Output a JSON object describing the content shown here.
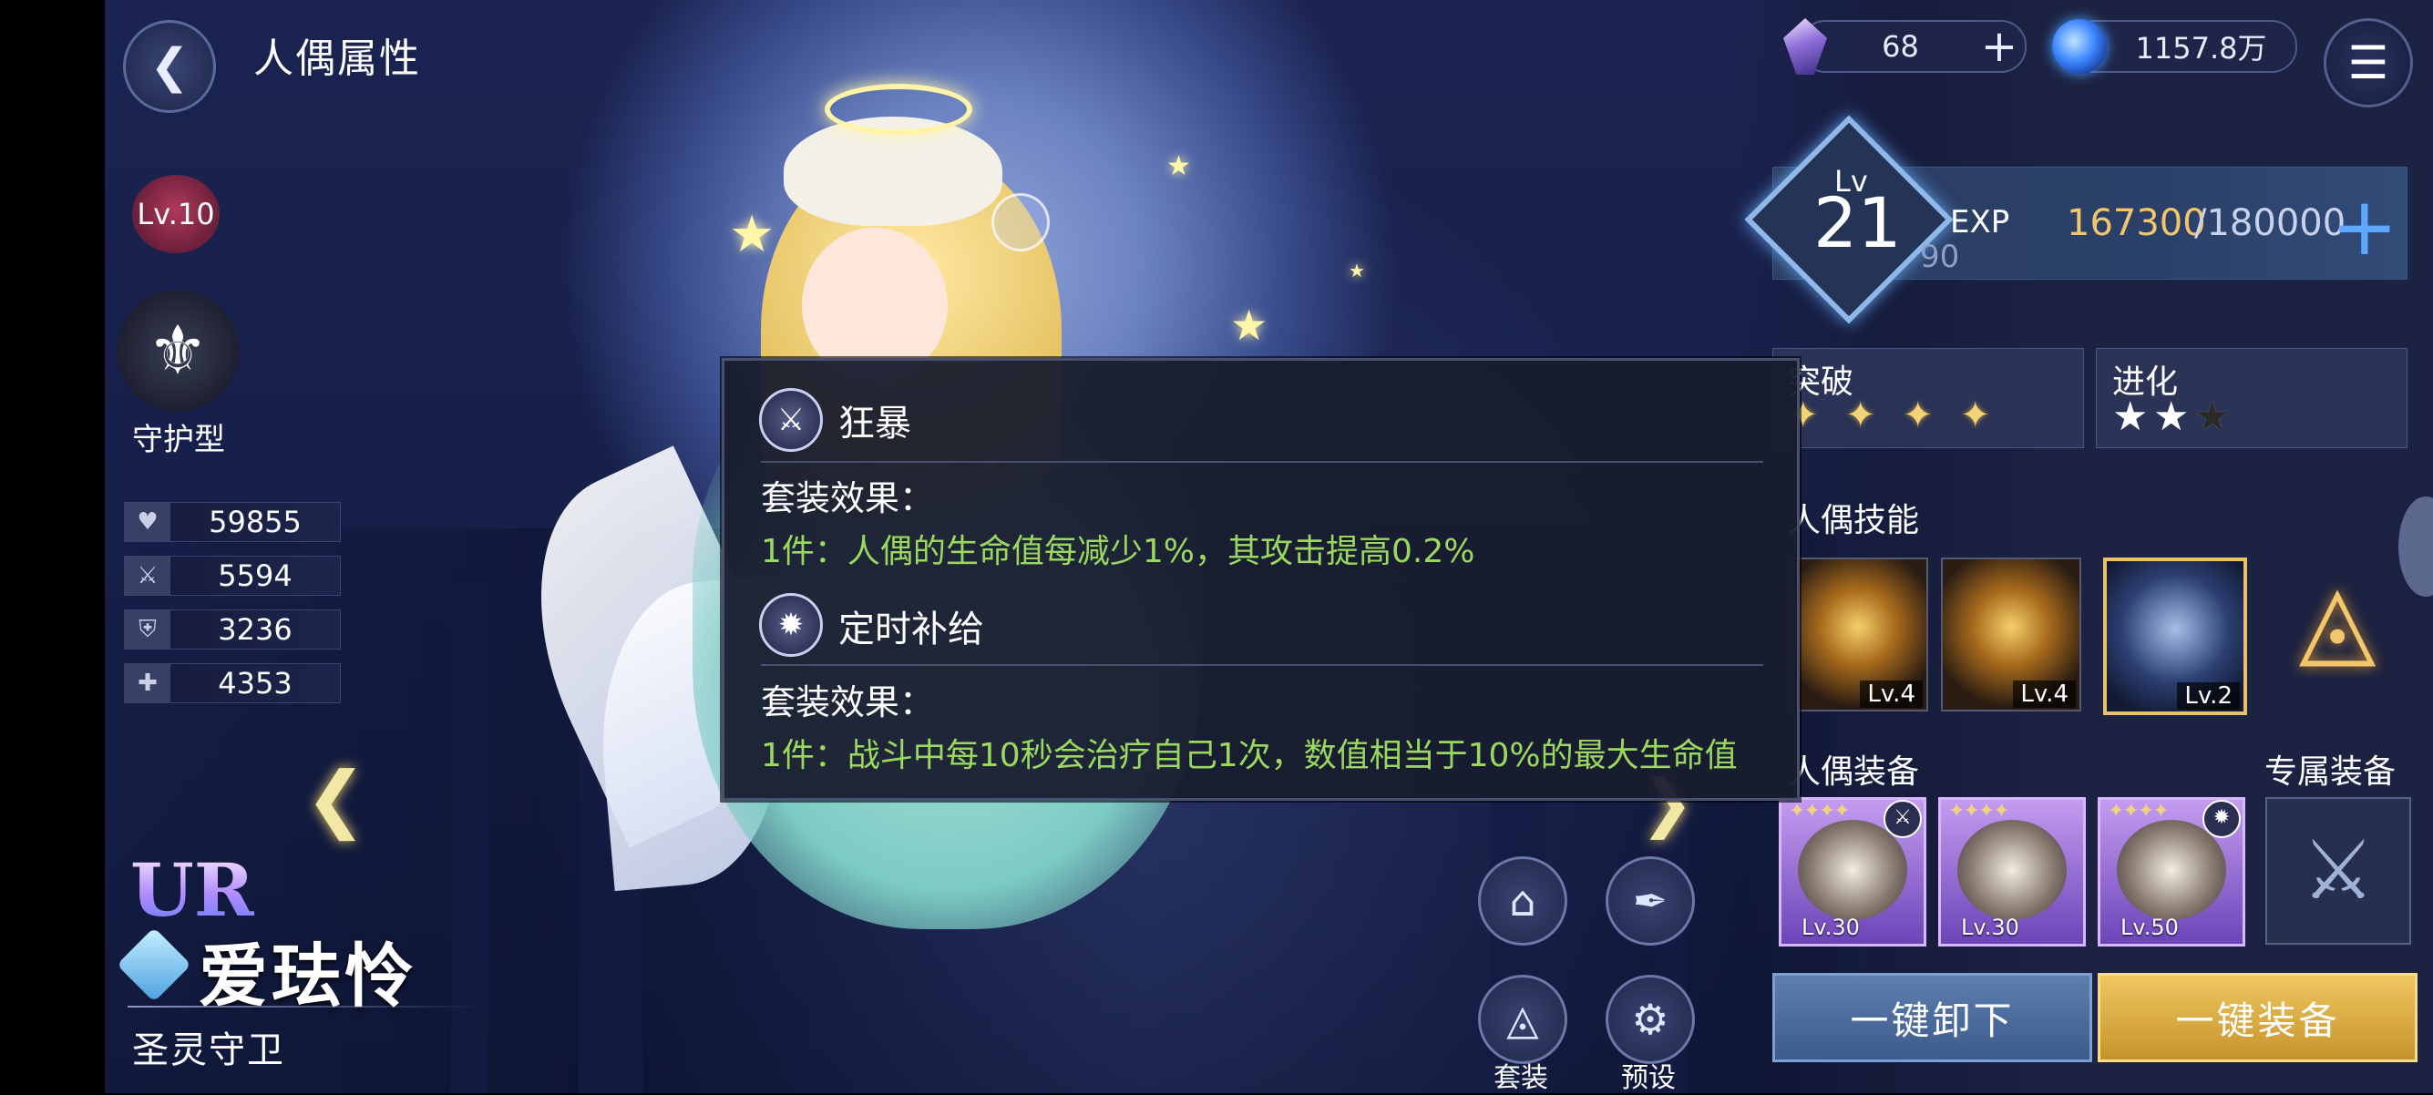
{
  "header": {
    "title": "人偶属性"
  },
  "currency": {
    "gems": "68",
    "gold": "1157.8万"
  },
  "affection": {
    "level": "Lv.10"
  },
  "unit_class": "守护型",
  "stats": [
    {
      "icon": "heart-icon",
      "value": "59855"
    },
    {
      "icon": "sword-icon",
      "value": "5594"
    },
    {
      "icon": "shield-icon",
      "value": "3236"
    },
    {
      "icon": "shield-cross-icon",
      "value": "4353"
    }
  ],
  "character": {
    "rarity": "UR",
    "name": "爱珐怜",
    "title": "圣灵守卫"
  },
  "actions": {
    "outfit_label": "",
    "pen_label": "",
    "set_label": "套装",
    "preset_label": "预设"
  },
  "tooltip": {
    "sets": [
      {
        "name": "狂暴",
        "heading": "套装效果：",
        "effect": "1件：人偶的生命值每减少1%，其攻击提高0.2%"
      },
      {
        "name": "定时补给",
        "heading": "套装效果：",
        "effect": "1件：战斗中每10秒会治疗自己1次，数值相当于10%的最大生命值"
      }
    ]
  },
  "level": {
    "lv_label": "Lv",
    "value": "21",
    "exp_label": "EXP",
    "exp_sub": "90",
    "exp_current": "167300",
    "exp_max": "/180000"
  },
  "breakthrough": {
    "title": "突破",
    "count": 4
  },
  "evolution": {
    "title": "进化",
    "filled": 2,
    "total": 3
  },
  "skills": {
    "title": "人偶技能",
    "items": [
      {
        "lv": "Lv.4"
      },
      {
        "lv": "Lv.4"
      },
      {
        "lv": "Lv.2"
      }
    ]
  },
  "equipment": {
    "title": "人偶装备",
    "exclusive_title": "专属装备",
    "items": [
      {
        "lv": "Lv.30"
      },
      {
        "lv": "Lv.30"
      },
      {
        "lv": "Lv.50"
      }
    ]
  },
  "buttons": {
    "unequip_all": "一键卸下",
    "equip_all": "一键装备"
  },
  "colors": {
    "exp_current": "#f2c66a",
    "set_effect": "#9bd860",
    "gold_button": "#e0b24a"
  }
}
